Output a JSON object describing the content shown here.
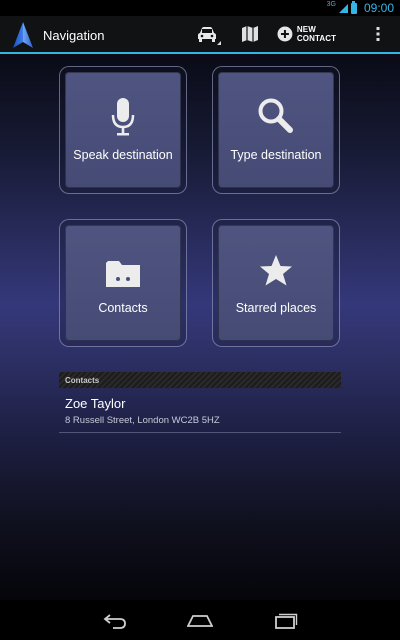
{
  "status_bar": {
    "network": "3G",
    "time": "09:00"
  },
  "action_bar": {
    "title": "Navigation",
    "new_contact_label": "NEW CONTACT",
    "icons": [
      "navigation-arrow-icon",
      "car-icon",
      "map-icon",
      "add-icon",
      "overflow-menu-icon"
    ]
  },
  "tiles": [
    {
      "label": "Speak destination",
      "icon": "microphone-icon"
    },
    {
      "label": "Type destination",
      "icon": "search-icon"
    },
    {
      "label": "Contacts",
      "icon": "folder-icon"
    },
    {
      "label": "Starred places",
      "icon": "star-icon"
    }
  ],
  "contacts": {
    "header": "Contacts",
    "items": [
      {
        "name": "Zoe Taylor",
        "address": "8 Russell Street, London WC2B 5HZ"
      }
    ]
  },
  "nav_bar": {
    "icons": [
      "back-icon",
      "home-icon",
      "recents-icon"
    ]
  },
  "colors": {
    "accent": "#33b5e5",
    "tile": "#4a5079",
    "action_bar": "#101214"
  }
}
